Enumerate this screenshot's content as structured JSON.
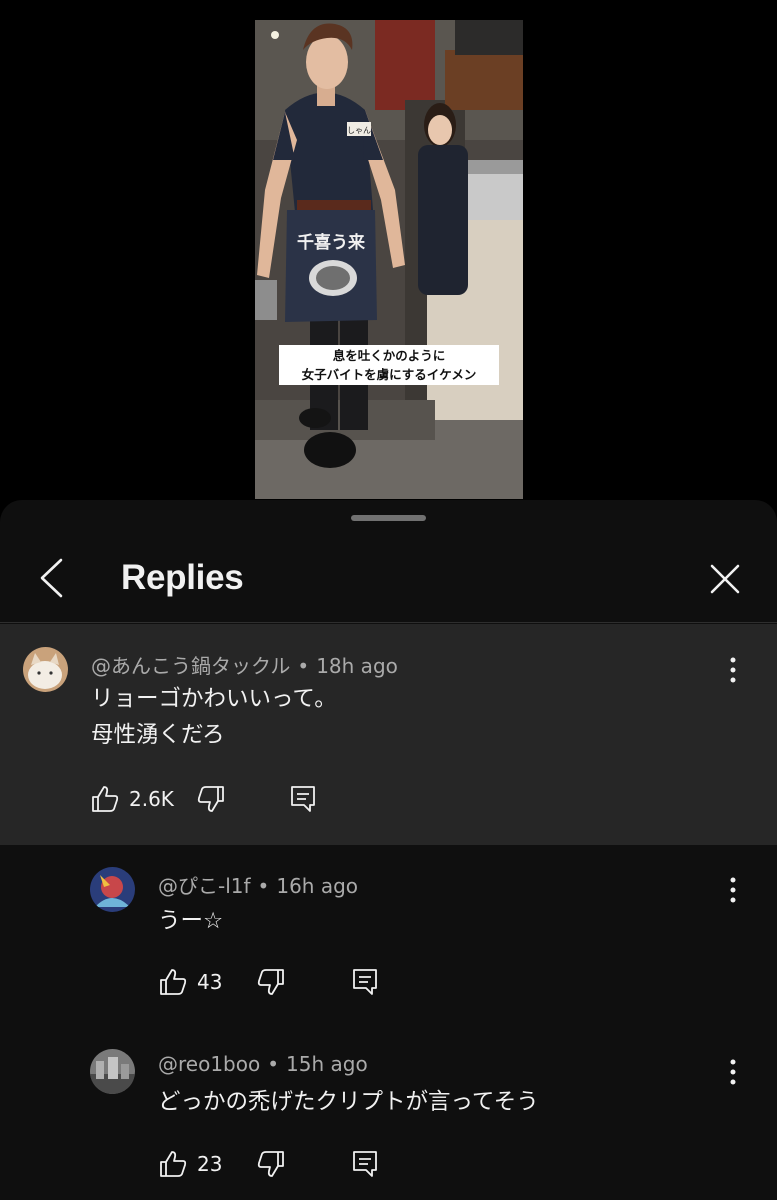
{
  "video": {
    "caption_line1": "息を吐くかのように",
    "caption_line2": "女子バイトを虜にするイケメン",
    "apron_text": "千喜う来",
    "name_tag": "しゃん"
  },
  "sheet": {
    "title": "Replies"
  },
  "parent_comment": {
    "handle": "@あんこう鍋タックル",
    "time": "18h ago",
    "text_line1": "リョーゴかわいいって。",
    "text_line2": "母性湧くだろ",
    "likes": "2.6K"
  },
  "replies": [
    {
      "handle": "@ぴこ-l1f",
      "time": "16h ago",
      "text": "うー☆",
      "likes": "43"
    },
    {
      "handle": "@reo1boo",
      "time": "15h ago",
      "text": "どっかの禿げたクリプトが言ってそう",
      "likes": "23"
    }
  ],
  "separator": "•",
  "icons": {
    "back": "chevron-left-icon",
    "close": "close-icon",
    "like": "thumbs-up-icon",
    "dislike": "thumbs-down-icon",
    "reply": "comment-reply-icon",
    "more": "more-vertical-icon"
  },
  "colors": {
    "background": "#000000",
    "sheet": "#0f0f0f",
    "highlight_comment": "#262626",
    "primary_text": "#f1f1f1",
    "secondary_text": "#aaaaaa"
  }
}
